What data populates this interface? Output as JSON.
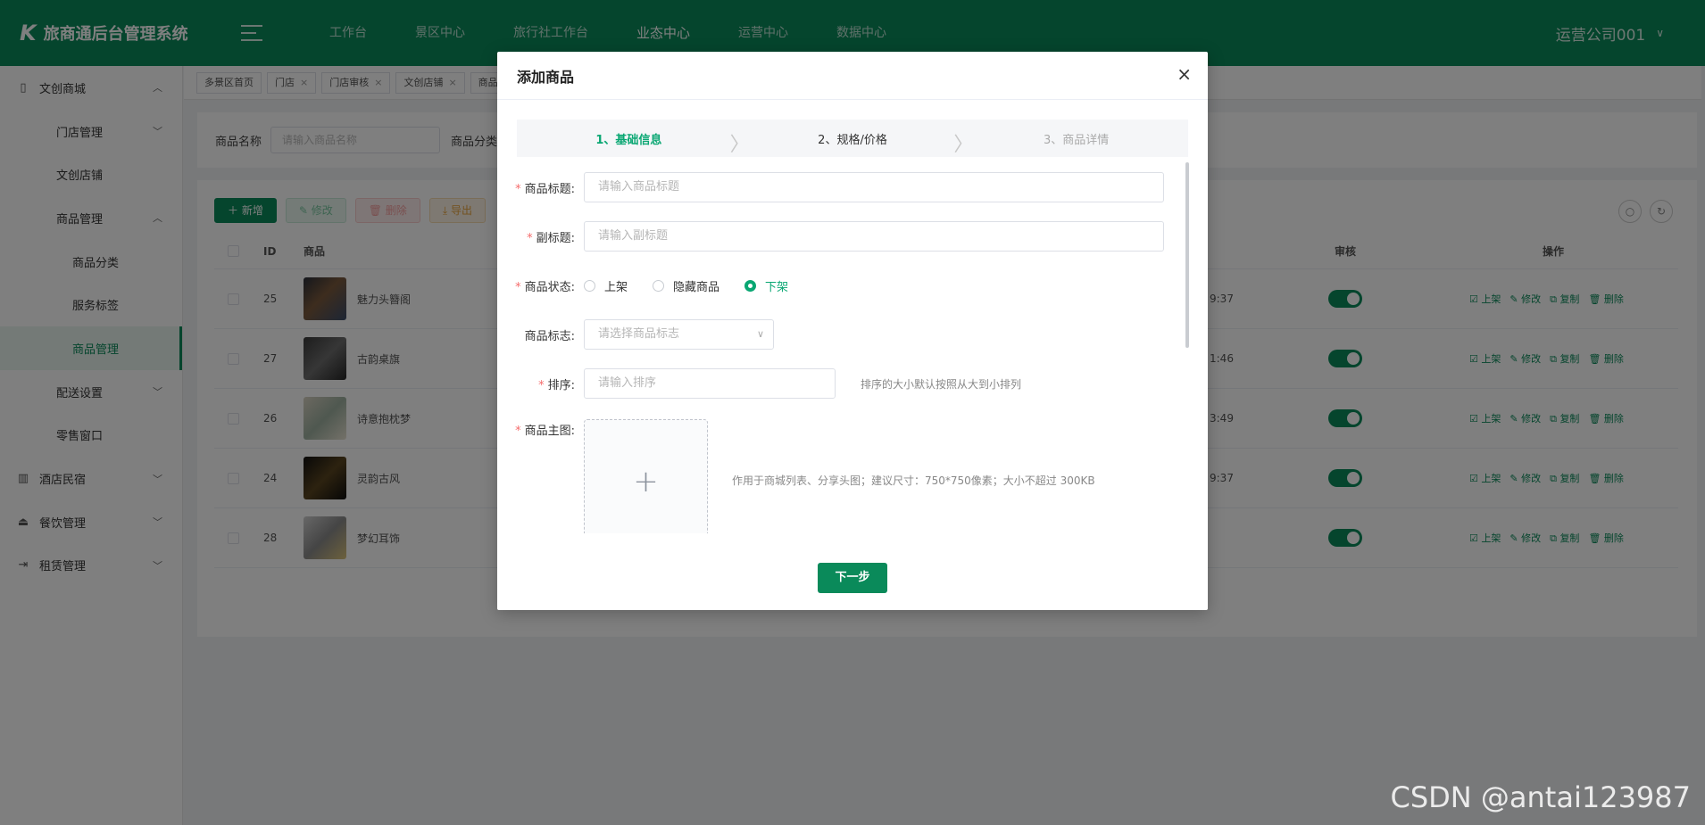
{
  "app": {
    "title": "旅商通后台管理系统",
    "logo_glyph": "K"
  },
  "top_nav": [
    {
      "label": "工作台"
    },
    {
      "label": "景区中心"
    },
    {
      "label": "旅行社工作台"
    },
    {
      "label": "业态中心"
    },
    {
      "label": "运营中心"
    },
    {
      "label": "数据中心"
    }
  ],
  "user": {
    "name": "运营公司001"
  },
  "sidebar": {
    "items": [
      {
        "label": "文创商城",
        "icon": "book-icon"
      },
      {
        "label": "门店管理"
      },
      {
        "label": "文创店铺"
      },
      {
        "label": "商品管理"
      },
      {
        "label": "商品分类"
      },
      {
        "label": "服务标签"
      },
      {
        "label": "商品管理"
      },
      {
        "label": "配送设置"
      },
      {
        "label": "零售窗口"
      },
      {
        "label": "酒店民宿",
        "icon": "building-icon"
      },
      {
        "label": "餐饮管理",
        "icon": "dish-icon"
      },
      {
        "label": "租赁管理",
        "icon": "exit-icon"
      }
    ]
  },
  "page_tabs": [
    "多景区首页",
    "门店",
    "门店审核",
    "文创店铺",
    "商品"
  ],
  "search": {
    "name_label": "商品名称",
    "name_placeholder": "请输入商品名称",
    "category_label": "商品分类"
  },
  "toolbar": {
    "add": "新增",
    "edit": "修改",
    "delete": "删除",
    "export": "导出"
  },
  "table": {
    "headers": {
      "id": "ID",
      "product": "商品",
      "audit": "审核",
      "ops": "操作"
    },
    "rows": [
      {
        "id": "25",
        "name": "魅力头簪阁",
        "time": "9:37"
      },
      {
        "id": "27",
        "name": "古韵桌旗",
        "time": "1:46"
      },
      {
        "id": "26",
        "name": "诗意抱枕梦",
        "time": "3:49"
      },
      {
        "id": "24",
        "name": "灵韵古风",
        "time": "9:37"
      },
      {
        "id": "28",
        "name": "梦幻耳饰",
        "time": ""
      }
    ],
    "ops": {
      "up": "上架",
      "edit": "修改",
      "copy": "复制",
      "delete": "删除"
    }
  },
  "dialog": {
    "title": "添加商品",
    "close": "×",
    "steps": [
      "1、基础信息",
      "2、规格/价格",
      "3、商品详情"
    ],
    "fields": {
      "title_label": "商品标题:",
      "title_placeholder": "请输入商品标题",
      "subtitle_label": "副标题:",
      "subtitle_placeholder": "请输入副标题",
      "status_label": "商品状态:",
      "status_options": [
        "上架",
        "隐藏商品",
        "下架"
      ],
      "status_selected": "下架",
      "flag_label": "商品标志:",
      "flag_placeholder": "请选择商品标志",
      "sort_label": "排序:",
      "sort_placeholder": "请输入排序",
      "sort_hint": "排序的大小默认按照从大到小排列",
      "image_label": "商品主图:",
      "image_hint": "作用于商城列表、分享头图；建议尺寸：750*750像素；大小不超过 300KB"
    },
    "next_button": "下一步"
  },
  "watermark": "CSDN @antai123987",
  "colors": {
    "primary": "#0a8a5a",
    "active_step": "#0aa773",
    "required": "#f56c6c"
  }
}
